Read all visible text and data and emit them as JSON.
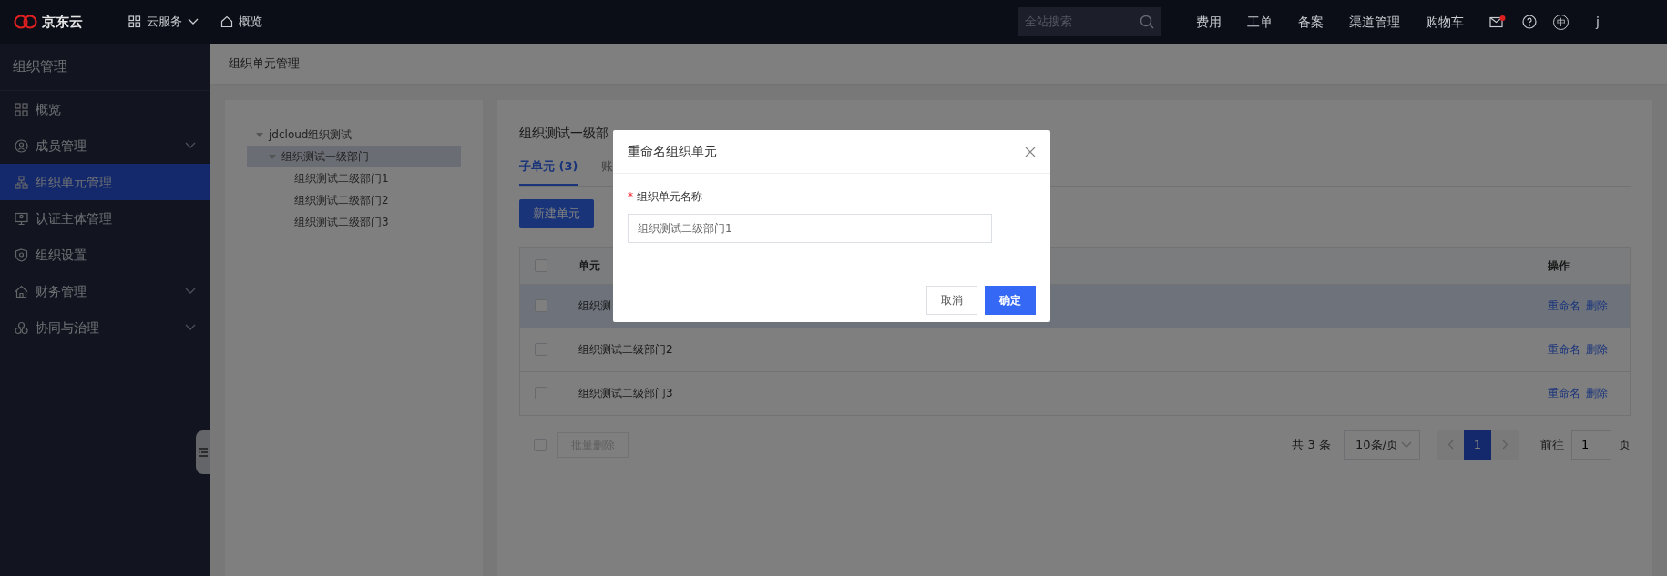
{
  "topbar": {
    "logo": "京东云",
    "nav": [
      {
        "label": "云服务",
        "kind": "menu"
      },
      {
        "label": "概览",
        "kind": "home"
      }
    ],
    "search": {
      "placeholder": "全站搜索"
    },
    "links": [
      "费用",
      "工单",
      "备案",
      "渠道管理",
      "购物车"
    ],
    "mail": {
      "unread": true
    },
    "language": "中",
    "user": "j"
  },
  "sidebar": {
    "title": "组织管理",
    "items": [
      {
        "label": "概览",
        "kind": "link",
        "selected": false
      },
      {
        "label": "成员管理",
        "kind": "group",
        "selected": false
      },
      {
        "label": "组织单元管理",
        "kind": "link",
        "selected": true
      },
      {
        "label": "认证主体管理",
        "kind": "link",
        "selected": false
      },
      {
        "label": "组织设置",
        "kind": "link",
        "selected": false
      },
      {
        "label": "财务管理",
        "kind": "group",
        "selected": false
      },
      {
        "label": "协同与治理",
        "kind": "group",
        "selected": false
      }
    ]
  },
  "breadcrumb": "组织单元管理",
  "tree": [
    {
      "label": "jdcloud组织测试",
      "expanded": true,
      "selected": false,
      "children": [
        {
          "label": "组织测试一级部门",
          "expanded": true,
          "selected": true,
          "children": [
            {
              "label": "组织测试二级部门1",
              "selected": false
            },
            {
              "label": "组织测试二级部门2",
              "selected": false
            },
            {
              "label": "组织测试二级部门3",
              "selected": false
            }
          ]
        }
      ]
    }
  ],
  "main": {
    "title": "组织测试一级部",
    "tabs": [
      {
        "label": "子单元 (3)",
        "selected": true
      },
      {
        "label": "账",
        "selected": false
      }
    ],
    "new_button": "新建单元",
    "table": {
      "columns": [
        "单元",
        "操作"
      ],
      "header_checked": false,
      "rows": [
        {
          "name": "组织测",
          "checked": false,
          "hovered": true,
          "actions": [
            "重命名",
            "删除"
          ]
        },
        {
          "name": "组织测试二级部门2",
          "checked": false,
          "hovered": false,
          "actions": [
            "重命名",
            "删除"
          ]
        },
        {
          "name": "组织测试二级部门3",
          "checked": false,
          "hovered": false,
          "actions": [
            "重命名",
            "删除"
          ]
        }
      ]
    },
    "bulk": {
      "checked": false,
      "label": "批量删除",
      "disabled": true
    },
    "pagination": {
      "total": "共 3 条",
      "page_size": "10条/页",
      "pages": [
        {
          "label": "1",
          "selected": true
        }
      ],
      "goto_label": "前往",
      "goto_value": "1",
      "page_suffix": "页"
    }
  },
  "dialog": {
    "title": "重命名组织单元",
    "field_label": "组织单元名称",
    "required_mark": "*",
    "value": "组织测试二级部门1",
    "cancel": "取消",
    "confirm": "确定"
  }
}
